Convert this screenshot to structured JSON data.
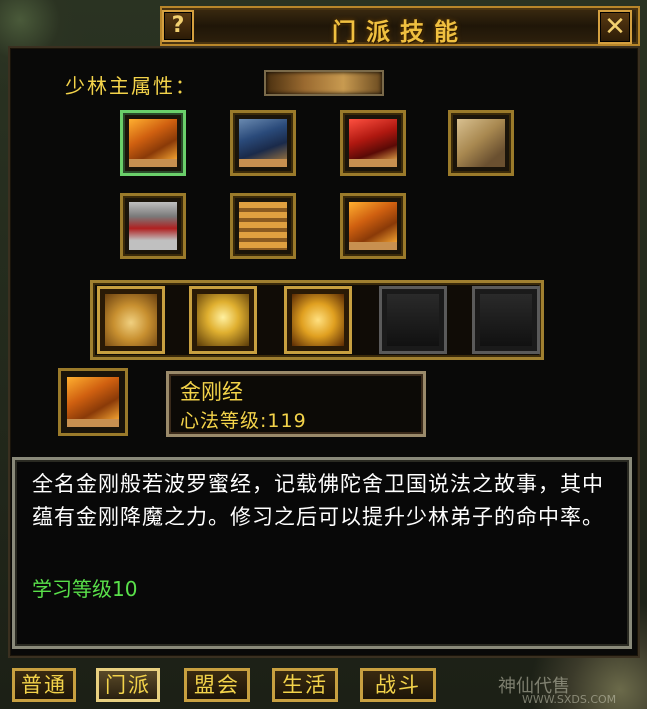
{
  "window": {
    "title": "门派技能",
    "help_label": "?",
    "close_label": "✕"
  },
  "attribute": {
    "label": "少林主属性："
  },
  "skill_books": [
    {
      "icon": "orange-book-icon",
      "selected": true
    },
    {
      "icon": "blue-book-icon",
      "selected": false
    },
    {
      "icon": "red-book-icon",
      "selected": false
    },
    {
      "icon": "map-scroll-icon",
      "selected": false
    },
    {
      "icon": "scroll-bundle-icon",
      "selected": false
    },
    {
      "icon": "book-stack-icon",
      "selected": false
    },
    {
      "icon": "orange-book-icon",
      "selected": false
    }
  ],
  "action_skills": [
    {
      "icon": "fist-icon"
    },
    {
      "icon": "golden-skull-icon"
    },
    {
      "icon": "buddha-face-icon"
    },
    {
      "icon": "empty-slot-icon"
    },
    {
      "icon": "empty-slot-icon"
    }
  ],
  "selected_skill": {
    "name": "金刚经",
    "level_text": "心法等级:119",
    "description": "全名金刚般若波罗蜜经，记载佛陀舍卫国说法之故事，其中蕴有金刚降魔之力。修习之后可以提升少林弟子的命中率。",
    "learn_level": "学习等级10"
  },
  "tabs": [
    {
      "label": "普通",
      "active": false
    },
    {
      "label": "门派",
      "active": true
    },
    {
      "label": "盟会",
      "active": false
    },
    {
      "label": "生活",
      "active": false
    },
    {
      "label": "战斗",
      "active": false
    }
  ],
  "watermark": {
    "text": "神仙代售",
    "url": "WWW.SXDS.COM"
  }
}
